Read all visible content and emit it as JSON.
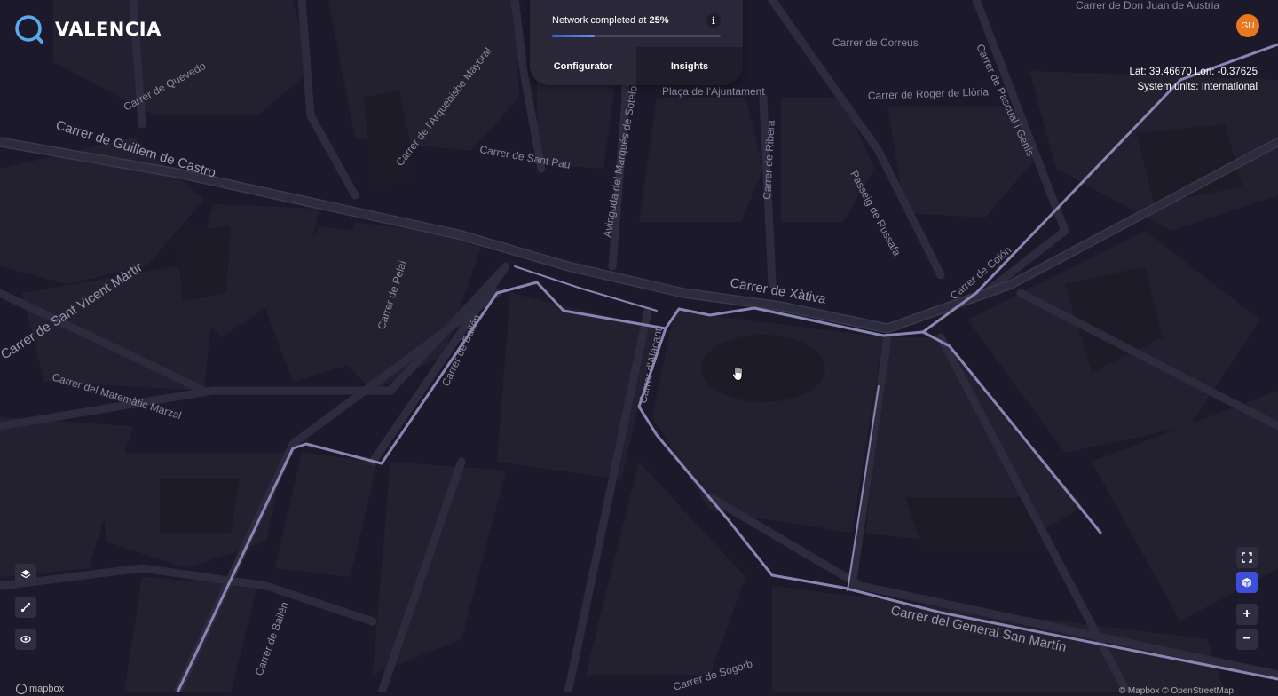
{
  "app": {
    "city_name": "VALENCIA",
    "logo_icon": "search-ring-icon"
  },
  "progress": {
    "label": "Network completed at",
    "percent_label": "25%",
    "fraction": 0.25,
    "info_label": "i"
  },
  "tabs": [
    {
      "label": "Configurator",
      "active": true
    },
    {
      "label": "Insights",
      "active": false
    }
  ],
  "user": {
    "initials": "GU",
    "color": "#e8771e"
  },
  "coords": {
    "latlon": "Lat: 39.46670 Lon: -0.37625",
    "units": "System units: International"
  },
  "left_controls": [
    {
      "icon": "layers-icon"
    },
    {
      "icon": "route-icon"
    },
    {
      "icon": "eye-icon"
    }
  ],
  "right_controls": {
    "fullscreen_icon": "fullscreen-icon",
    "cube_icon": "3d-cube-icon",
    "zoom_in": "+",
    "zoom_out": "−"
  },
  "attribution": {
    "left": "mapbox",
    "right": "© Mapbox © OpenStreetMap"
  },
  "streets": [
    "Carrer de Guillem de Castro",
    "Carrer de Quevedo",
    "Carrer de l'Arquebisbe Mayoral",
    "Carrer de Sant Pau",
    "Avinguda del Marqués de Sotelo",
    "Plaça de l'Ajuntament",
    "Carrer de Correus",
    "Carrer de Roger de Llòria",
    "Carrer de Pascual i Genís",
    "Carrer de Ribera",
    "Passeig de Russafa",
    "Carrer de Colón",
    "Carrer de Xàtiva",
    "Carrer de Sant Vicent Màrtir",
    "Carrer de Pelai",
    "Carrer de Bailén",
    "Carrer d'Alacant",
    "Carrer del Matemàtic Marzal",
    "Carrer de Bailén",
    "Carrer del General San Martín",
    "Carrer de Sogorb",
    "Carrer de Don Juan de Austria"
  ],
  "colors": {
    "map_background": "#1c1a2a",
    "road": "#2a2838",
    "network_route": "#8d89b8",
    "accent": "#3b4fd8"
  }
}
